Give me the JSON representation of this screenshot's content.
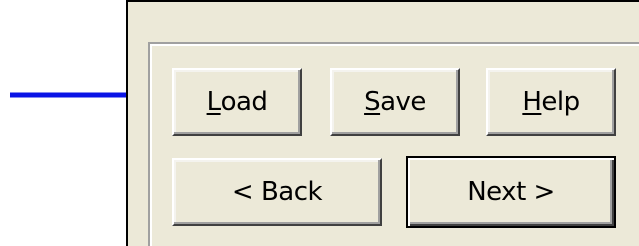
{
  "buttons": {
    "load": {
      "mnemonic": "L",
      "rest": "oad"
    },
    "save": {
      "mnemonic": "S",
      "rest": "ave"
    },
    "help": {
      "mnemonic": "H",
      "rest": "elp"
    },
    "back": "< Back",
    "next": "Next >"
  },
  "colors": {
    "dialog_face": "#ece9d8",
    "annotation_arrow": "#0a14e6"
  },
  "icons": {
    "pointer": "arrow-right-icon"
  }
}
